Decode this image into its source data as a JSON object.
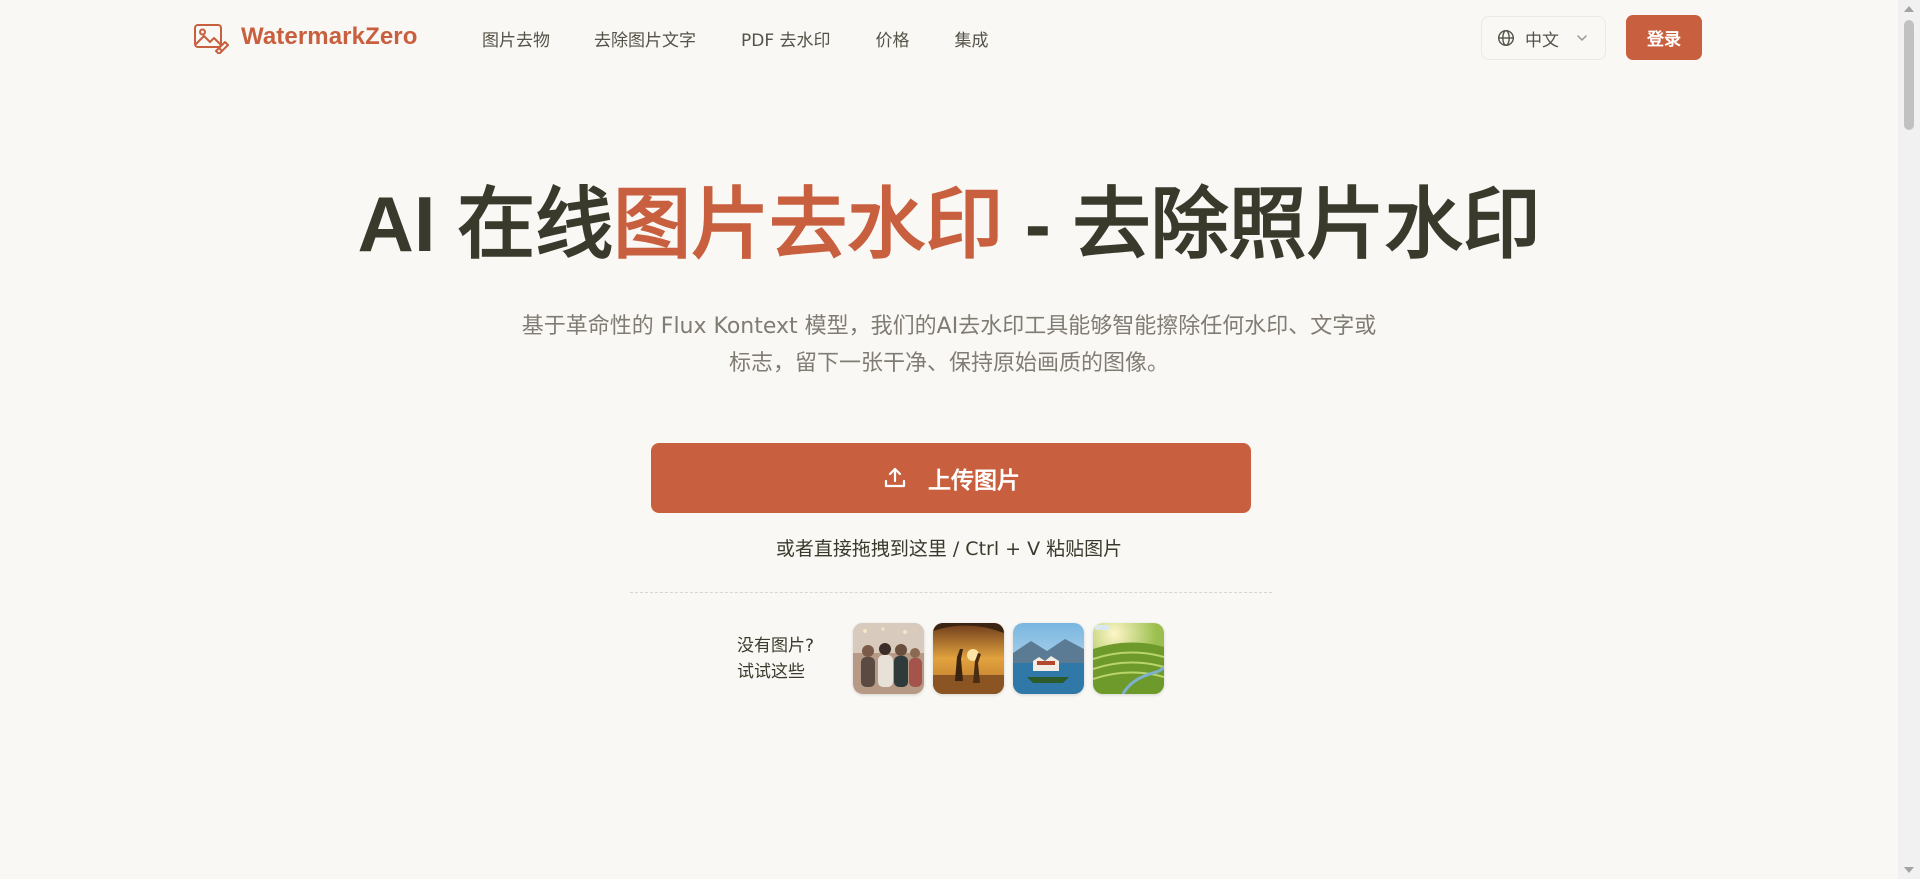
{
  "header": {
    "brand": "WatermarkZero",
    "nav": [
      "图片去物",
      "去除图片文字",
      "PDF 去水印",
      "价格",
      "集成"
    ],
    "language": "中文",
    "login_label": "登录"
  },
  "hero": {
    "title_prefix": "AI 在线",
    "title_accent": "图片去水印",
    "title_suffix": " - 去除照片水印",
    "description_line1": "基于革命性的 Flux Kontext 模型，我们的AI去水印工具能够智能擦除任何水印、文字或",
    "description_line2": "标志，留下一张干净、保持原始画质的图像。",
    "upload_label": "上传图片",
    "drop_hint": "或者直接拖拽到这里 / Ctrl + V 粘贴图片",
    "samples_label_line1": "没有图片?",
    "samples_label_line2": "试试这些"
  },
  "colors": {
    "accent": "#c8603f",
    "text": "#3a3a2c",
    "muted": "#807c74",
    "background": "#faf8f5"
  },
  "icons": {
    "logo": "image-eraser-icon",
    "language": "globe-icon",
    "dropdown": "chevron-down-icon",
    "upload": "upload-icon"
  }
}
